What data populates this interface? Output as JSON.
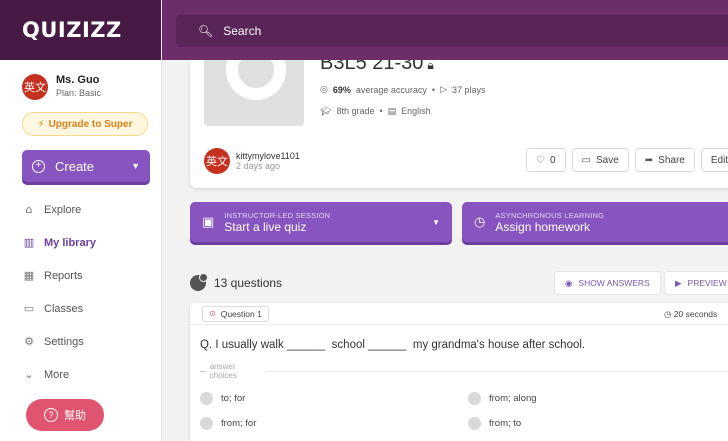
{
  "brand": {
    "logo": "QUIZIZZ"
  },
  "user": {
    "name": "Ms. Guo",
    "plan": "Plan: Basic",
    "avatar_text": "英文"
  },
  "sidebar": {
    "upgrade_label": "Upgrade to Super",
    "create_label": "Create",
    "items": [
      {
        "label": "Explore",
        "icon": "explore-icon",
        "glyph": "⌂"
      },
      {
        "label": "My library",
        "icon": "library-icon",
        "glyph": "▥"
      },
      {
        "label": "Reports",
        "icon": "reports-icon",
        "glyph": "▦"
      },
      {
        "label": "Classes",
        "icon": "classes-icon",
        "glyph": "▭"
      },
      {
        "label": "Settings",
        "icon": "settings-icon",
        "glyph": "⚙"
      },
      {
        "label": "More",
        "icon": "chevron-down-icon",
        "glyph": "⌄"
      }
    ],
    "help_label": "幫助"
  },
  "search": {
    "placeholder": "Search"
  },
  "quiz": {
    "title": "B3L5 21-30",
    "accuracy": "69%",
    "accuracy_label": "average accuracy",
    "plays": "37 plays",
    "grade": "8th grade",
    "subject": "English",
    "author": "kittymylove1101",
    "author_avatar_text": "英文",
    "time_ago": "2 days ago",
    "likes": "0",
    "save_label": "Save",
    "share_label": "Share",
    "edit_label": "Edit"
  },
  "modes": {
    "live": {
      "sub": "INSTRUCTOR-LED SESSION",
      "main": "Start a live quiz"
    },
    "homework": {
      "sub": "ASYNCHRONOUS LEARNING",
      "main": "Assign homework"
    }
  },
  "questions": {
    "count_label": "13 questions",
    "show_answers_label": "SHOW ANSWERS",
    "preview_label": "PREVIEW",
    "items": [
      {
        "tag": "Question 1",
        "time": "20 seconds",
        "text": "Q. I usually walk ______  school ______  my grandma's house after school.",
        "choices_label": "answer choices",
        "choices": [
          "to; for",
          "from; along",
          "from; for",
          "from; to"
        ]
      }
    ]
  },
  "colors": {
    "brand_dark": "#461a42",
    "topbar": "#6b2e6a",
    "accent": "#8854c0",
    "help": "#e05470"
  }
}
